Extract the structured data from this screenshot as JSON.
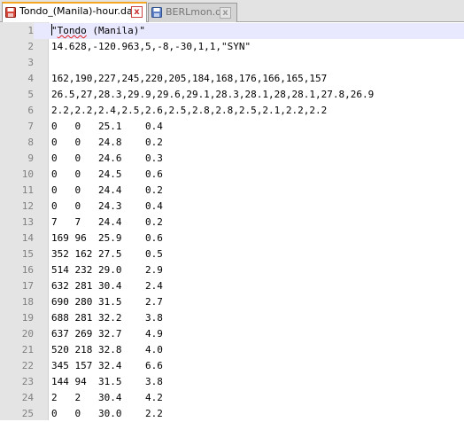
{
  "tabs": [
    {
      "label": "Tondo_(Manila)-hour.dat",
      "active": true,
      "icon": "floppy-disk-red-icon",
      "close": "x"
    },
    {
      "label": "BERLmon.dat",
      "active": false,
      "icon": "floppy-disk-blue-icon",
      "close": "x"
    }
  ],
  "editor": {
    "line1_quote_open": "\"",
    "line1_word1": "Tondo",
    "line1_rest": " (Manila)\"",
    "lines": [
      "",
      "14.628,-120.963,5,-8,-30,1,1,\"SYN\"",
      "",
      "162,190,227,245,220,205,184,168,176,166,165,157",
      "26.5,27,28.3,29.9,29.6,29.1,28.3,28.1,28,28.1,27.8,26.9",
      "2.2,2.2,2.4,2.5,2.6,2.5,2.8,2.8,2.5,2.1,2.2,2.2",
      "0   0   25.1    0.4",
      "0   0   24.8    0.2",
      "0   0   24.6    0.3",
      "0   0   24.5    0.6",
      "0   0   24.4    0.2",
      "0   0   24.3    0.4",
      "7   7   24.4    0.2",
      "169 96  25.9    0.6",
      "352 162 27.5    0.5",
      "514 232 29.0    2.9",
      "632 281 30.4    2.4",
      "690 280 31.5    2.7",
      "688 281 32.2    3.8",
      "637 269 32.7    4.9",
      "520 218 32.8    4.0",
      "345 157 32.4    6.6",
      "144 94  31.5    3.8",
      "2   2   30.4    4.2",
      "0   0   30.0    2.2"
    ],
    "line_numbers": [
      "1",
      "2",
      "3",
      "4",
      "5",
      "6",
      "7",
      "8",
      "9",
      "10",
      "11",
      "12",
      "13",
      "14",
      "15",
      "16",
      "17",
      "18",
      "19",
      "20",
      "21",
      "22",
      "23",
      "24",
      "25"
    ],
    "current_line_color": "#e8e8ff",
    "gutter_color": "#e4e4e4",
    "active_tab_accent": "#f5a623"
  }
}
